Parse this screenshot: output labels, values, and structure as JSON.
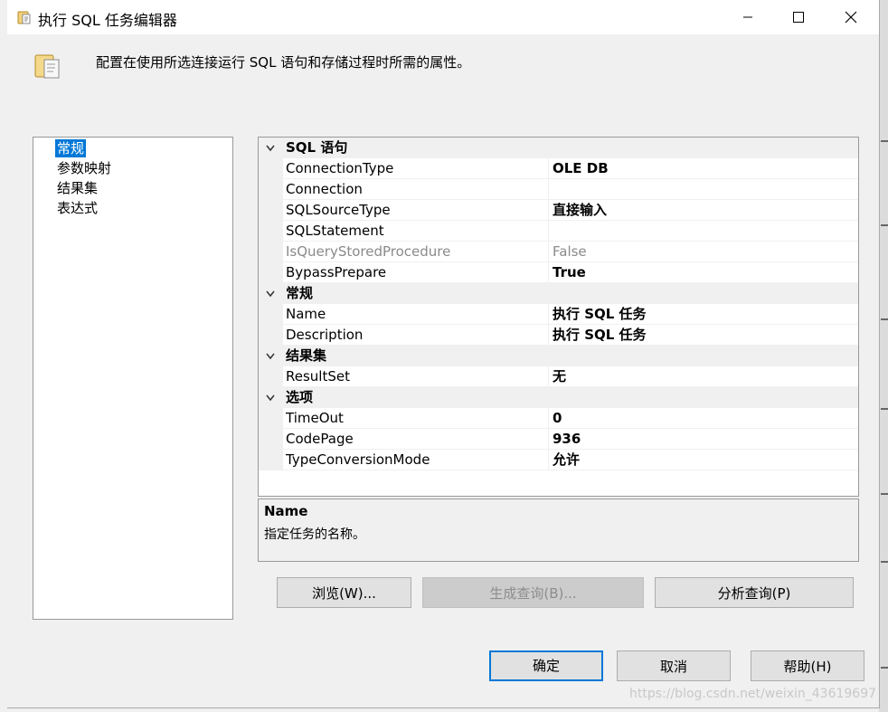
{
  "window": {
    "title": "执行 SQL 任务编辑器",
    "minimize_icon": "minimize-icon",
    "maximize_icon": "maximize-icon",
    "close_icon": "close-icon"
  },
  "header": {
    "description": "配置在使用所选连接运行 SQL 语句和存储过程时所需的属性。",
    "icon": "scroll-folder-icon"
  },
  "nav": {
    "items": [
      {
        "label": "常规",
        "selected": true
      },
      {
        "label": "参数映射",
        "selected": false
      },
      {
        "label": "结果集",
        "selected": false
      },
      {
        "label": "表达式",
        "selected": false
      }
    ]
  },
  "grid": {
    "categories": [
      {
        "label": "SQL 语句",
        "rows": [
          {
            "name": "ConnectionType",
            "value": "OLE DB"
          },
          {
            "name": "Connection",
            "value": ""
          },
          {
            "name": "SQLSourceType",
            "value": "直接输入"
          },
          {
            "name": "SQLStatement",
            "value": ""
          },
          {
            "name": "IsQueryStoredProcedure",
            "value": "False",
            "disabled": true
          },
          {
            "name": "BypassPrepare",
            "value": "True"
          }
        ]
      },
      {
        "label": "常规",
        "rows": [
          {
            "name": "Name",
            "value": "执行 SQL 任务"
          },
          {
            "name": "Description",
            "value": "执行 SQL 任务"
          }
        ]
      },
      {
        "label": "结果集",
        "rows": [
          {
            "name": "ResultSet",
            "value": "无"
          }
        ]
      },
      {
        "label": "选项",
        "rows": [
          {
            "name": "TimeOut",
            "value": "0"
          },
          {
            "name": "CodePage",
            "value": "936"
          },
          {
            "name": "TypeConversionMode",
            "value": "允许"
          }
        ]
      }
    ]
  },
  "description_panel": {
    "title": "Name",
    "text": "指定任务的名称。"
  },
  "buttons": {
    "browse": "浏览(W)...",
    "build_query": "生成查询(B)...",
    "parse_query": "分析查询(P)",
    "ok": "确定",
    "cancel": "取消",
    "help": "帮助(H)"
  },
  "watermark": "https://blog.csdn.net/weixin_43619697"
}
